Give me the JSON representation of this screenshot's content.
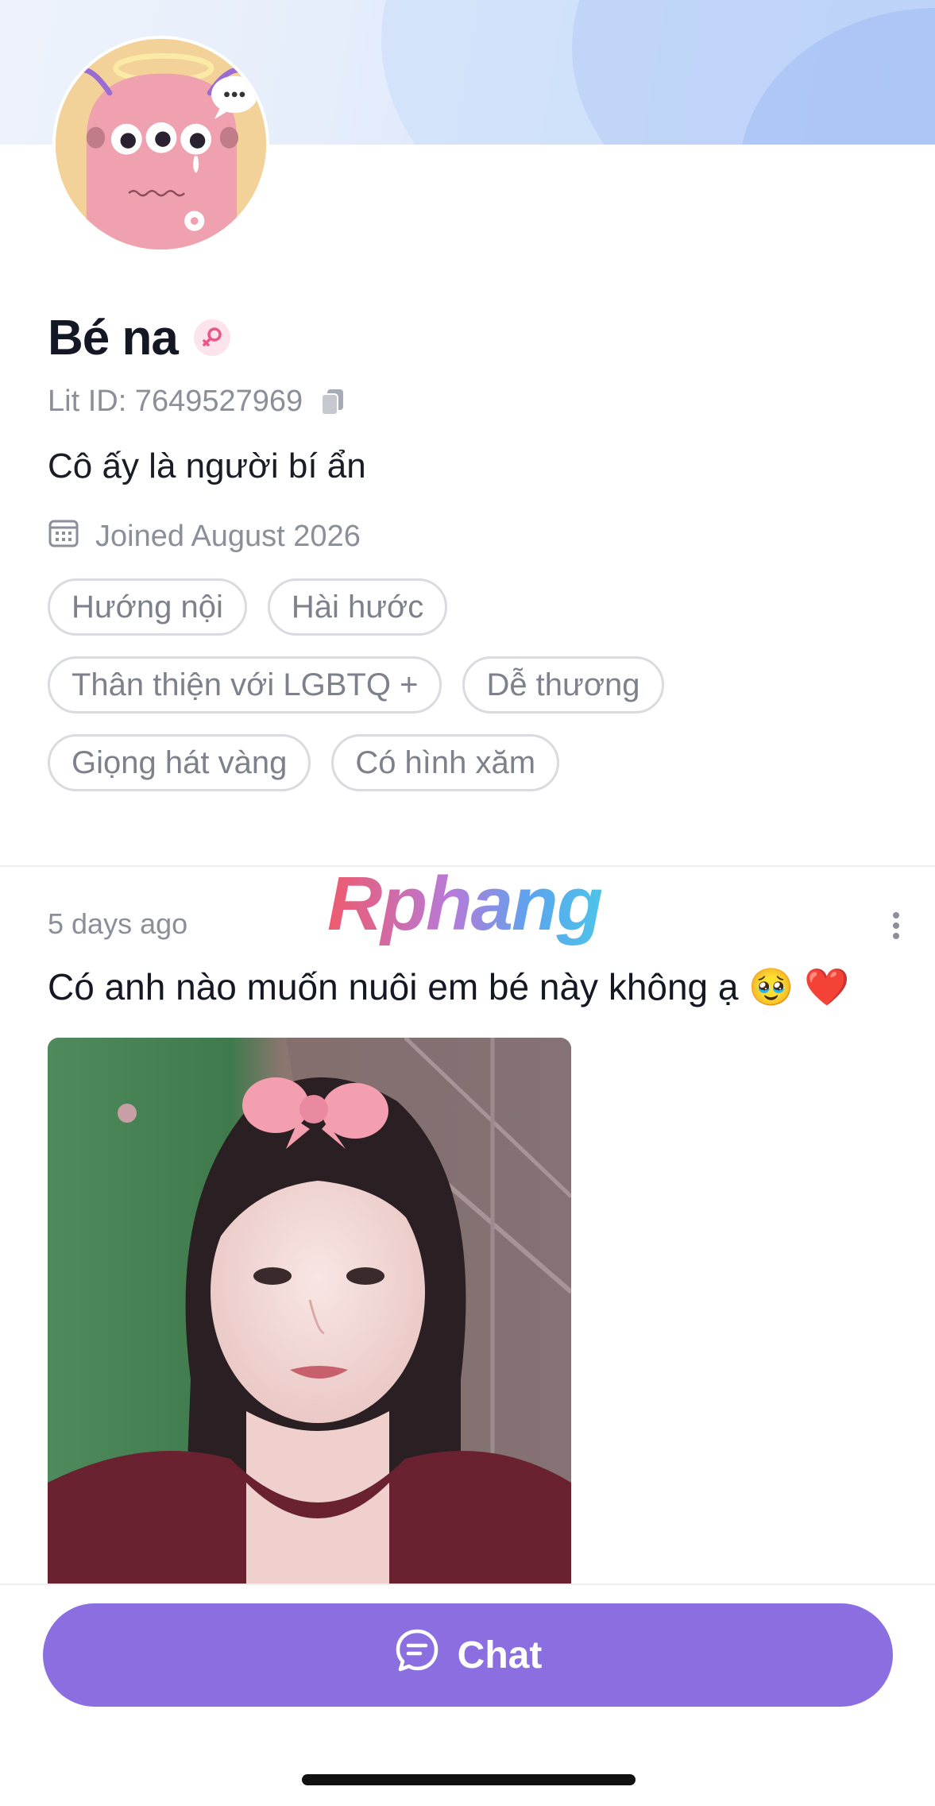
{
  "profile": {
    "name": "Bé na",
    "gender_icon": "female-icon",
    "lit_id": "Lit ID: 7649527969",
    "bio": "Cô ấy là người bí ẩn",
    "joined": "Joined August 2026",
    "tags": [
      [
        "Hướng nội",
        "Hài hước"
      ],
      [
        "Thân thiện với LGBTQ +",
        "Dễ thương"
      ],
      [
        "Giọng hát vàng",
        "Có hình xăm"
      ]
    ]
  },
  "post": {
    "time": "5 days ago",
    "text": "Có anh nào muốn nuôi em bé này không ạ 🥹 ❤️",
    "watermark": "Rphang"
  },
  "actions": {
    "chat_label": "Chat"
  },
  "colors": {
    "accent": "#8b6fe0",
    "gender_pink": "#e9578a"
  }
}
